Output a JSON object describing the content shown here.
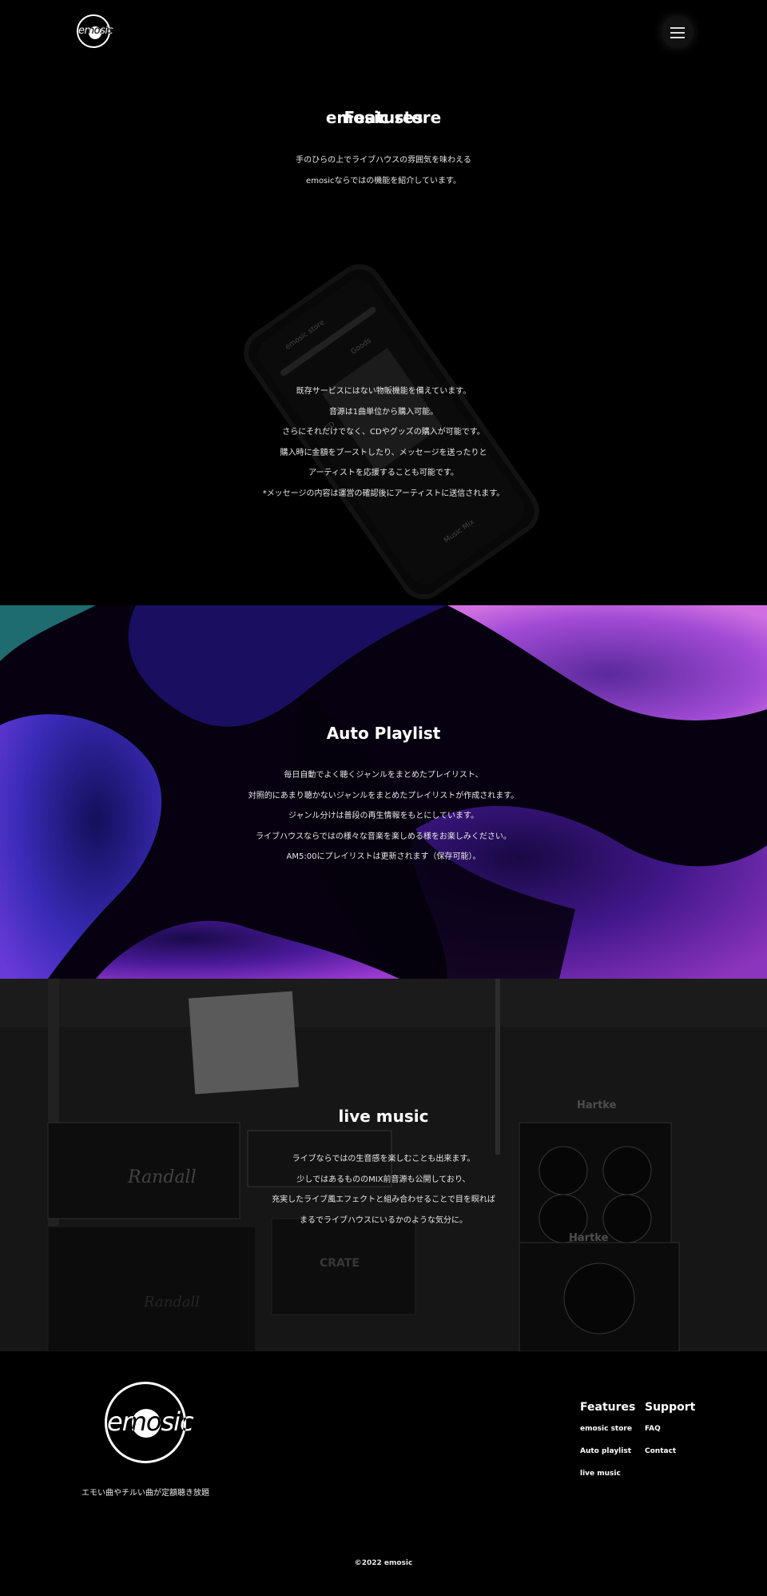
{
  "header": {
    "logo_text": "emosic",
    "menu_icon": "hamburger-icon"
  },
  "features": {
    "title": "Features",
    "intro": [
      "手のひらの上でライブハウスの雰囲気を味わえる",
      "emosicならではの機能を紹介しています。"
    ]
  },
  "store": {
    "title": "emosic store",
    "lines": [
      "既存サービスにはない物販機能を備えています。",
      "音源は1曲単位から購入可能。",
      "さらにそれだけでなく、CDやグッズの購入が可能です。",
      "購入時に金額をブーストしたり、メッセージを送ったりと",
      "アーティストを応援することも可能です。",
      "*メッセージの内容は運営の確認後にアーティストに送信されます。"
    ],
    "phone_screen": {
      "header": "emosic store",
      "items": [
        "Goods",
        "CD",
        "Music Mix"
      ]
    }
  },
  "playlist": {
    "title": "Auto Playlist",
    "lines": [
      "毎日自動でよく聴くジャンルをまとめたプレイリスト、",
      "対照的にあまり聴かないジャンルをまとめたプレイリストが作成されます。",
      "ジャンル分けは普段の再生情報をもとにしています。",
      "ライブハウスならではの様々な音楽を楽しめる様をお楽しみください。",
      "AM5:00にプレイリストは更新されます（保存可能）。"
    ],
    "colors": {
      "violet": "#7b2fd0",
      "blue": "#2a2fd0",
      "pink": "#c05ad8",
      "teal": "#2a9a9a"
    }
  },
  "live": {
    "title": "live music",
    "lines": [
      "ライブならではの生音感を楽しむことも出来ます。",
      "少しではあるもののMIX前音源も公開しており、",
      "充実したライブ風エフェクトと組み合わせることで目を瞑れば",
      "まるでライブハウスにいるかのような気分に。"
    ],
    "amp_labels": [
      "Randall",
      "Hartke",
      "Hartke",
      "CRATE",
      "Randall"
    ]
  },
  "footer": {
    "logo_text": "emosic",
    "tagline": "エモい曲やチルい曲が定額聴き放題",
    "columns": [
      {
        "heading": "Features",
        "links": [
          "emosic store",
          "Auto playlist",
          "live music"
        ]
      },
      {
        "heading": "Support",
        "links": [
          "FAQ",
          "Contact"
        ]
      }
    ],
    "copyright": "©2022 emosic"
  }
}
